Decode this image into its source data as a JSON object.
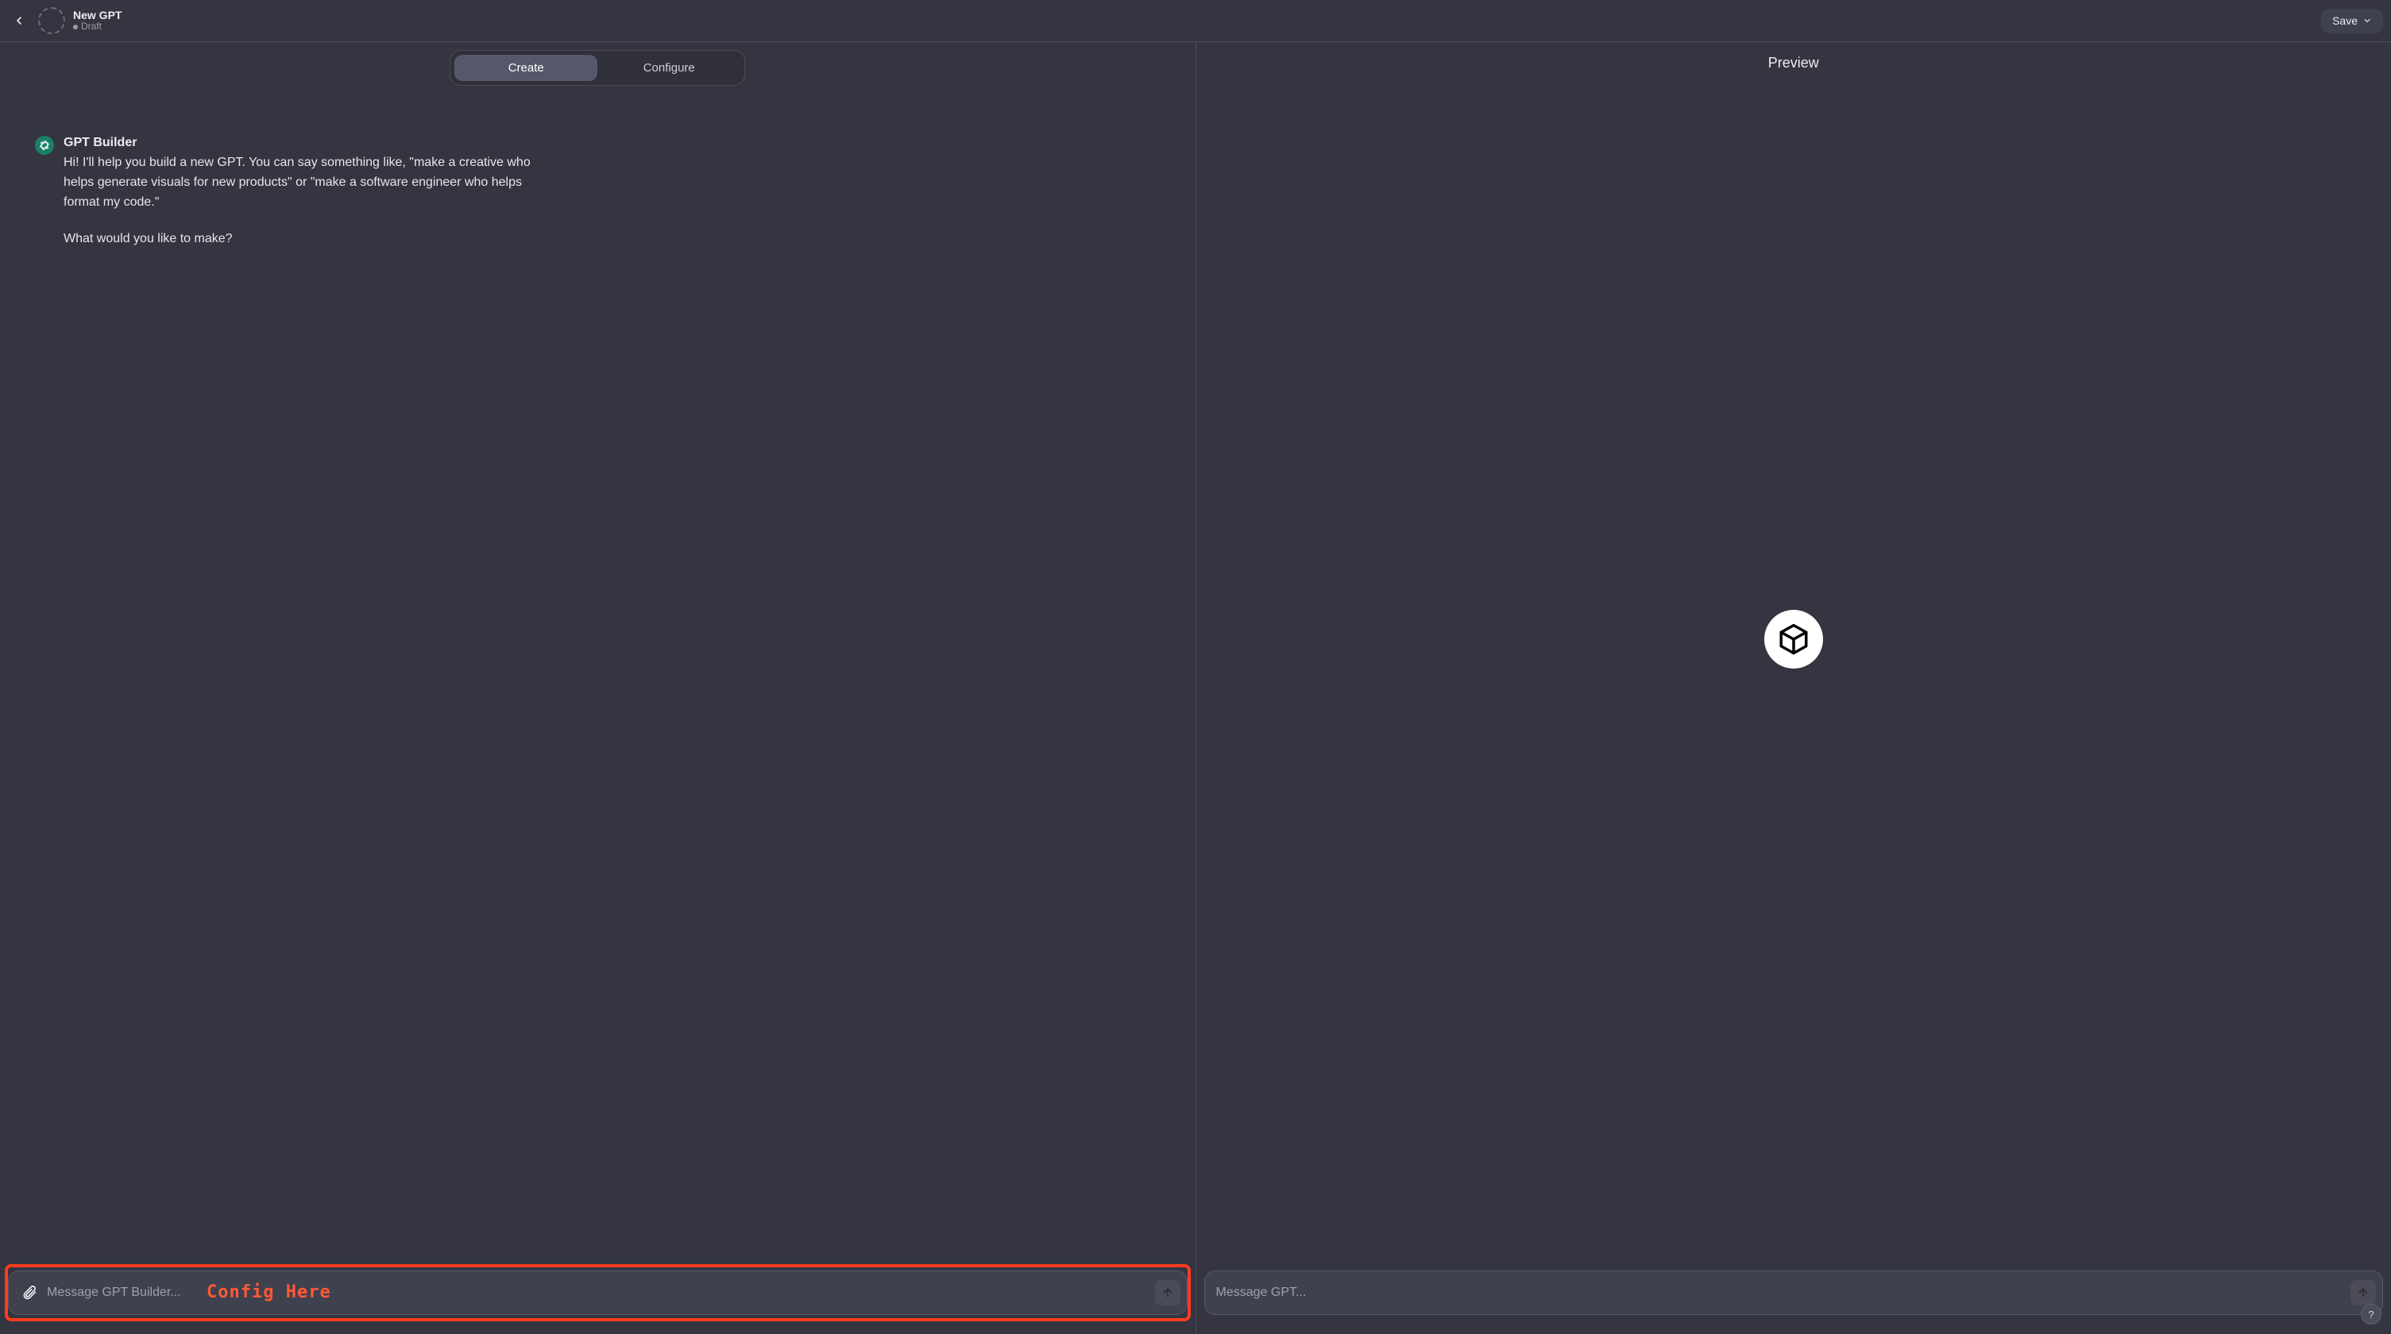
{
  "header": {
    "title": "New GPT",
    "status": "Draft",
    "save_label": "Save"
  },
  "tabs": {
    "create": "Create",
    "configure": "Configure",
    "active": "create"
  },
  "builder": {
    "avatar": "GPT Builder",
    "p1": "Hi! I'll help you build a new GPT. You can say something like, \"make a creative who helps generate visuals for new products\" or \"make a software engineer who helps format my code.\"",
    "p2": "What would you like to make?"
  },
  "composer_left": {
    "placeholder": "Message GPT Builder..."
  },
  "composer_right": {
    "placeholder": "Message GPT..."
  },
  "preview": {
    "title": "Preview"
  },
  "annotation": {
    "label": "Config Here"
  },
  "help": {
    "glyph": "?"
  }
}
